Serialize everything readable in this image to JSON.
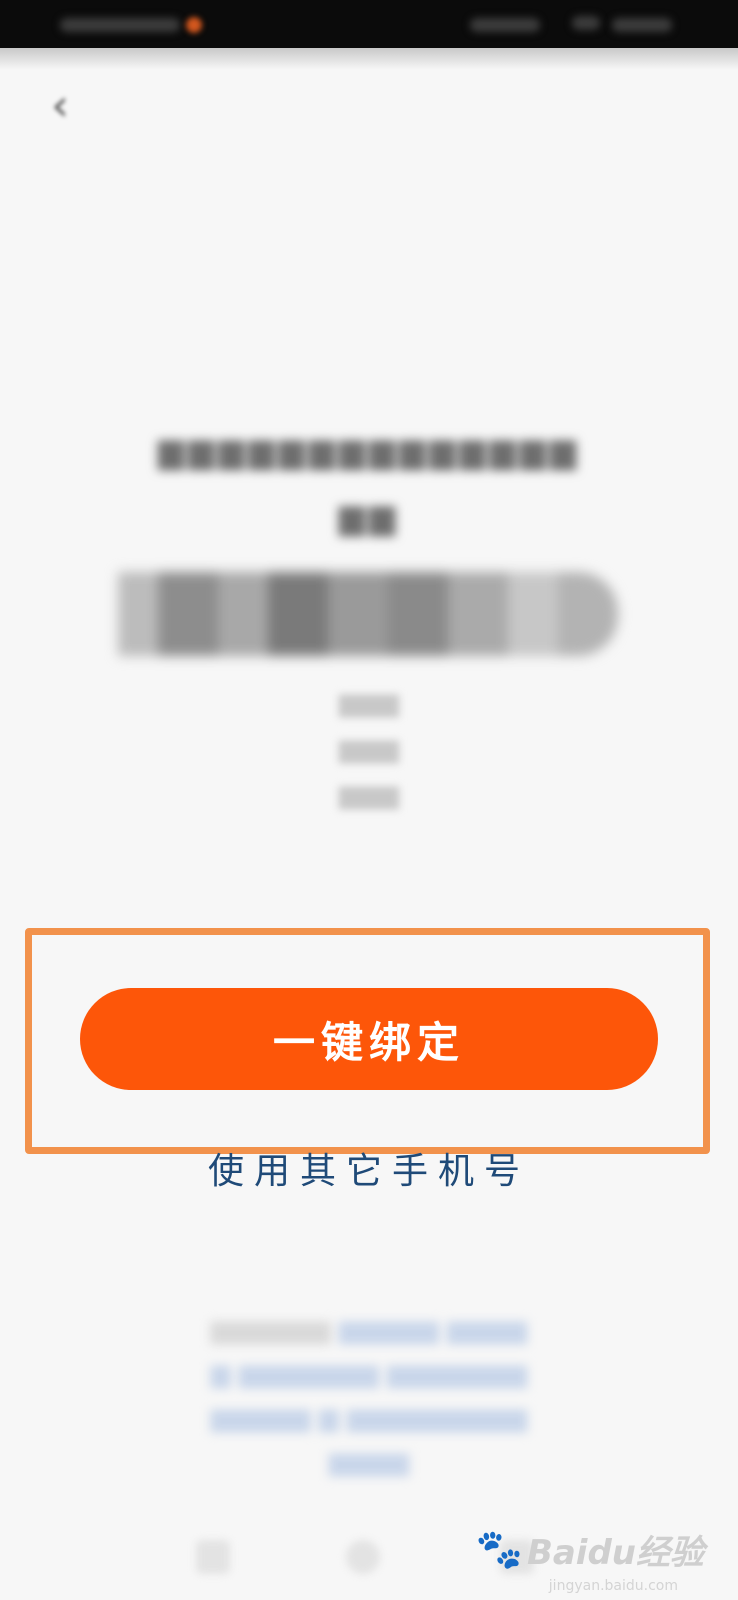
{
  "nav": {
    "back_icon": "‹"
  },
  "content": {
    "bind_button_label": "一键绑定",
    "other_phone_link": "使用其它手机号"
  },
  "watermark": {
    "logo_text": "Baidu经验",
    "sub_text": "jingyan.baidu.com"
  },
  "colors": {
    "primary_button": "#fd5609",
    "highlight_border": "#f2924c",
    "link_text": "#1f4a78",
    "status_bar": "#0b0b0b",
    "background": "#f7f7f7"
  }
}
